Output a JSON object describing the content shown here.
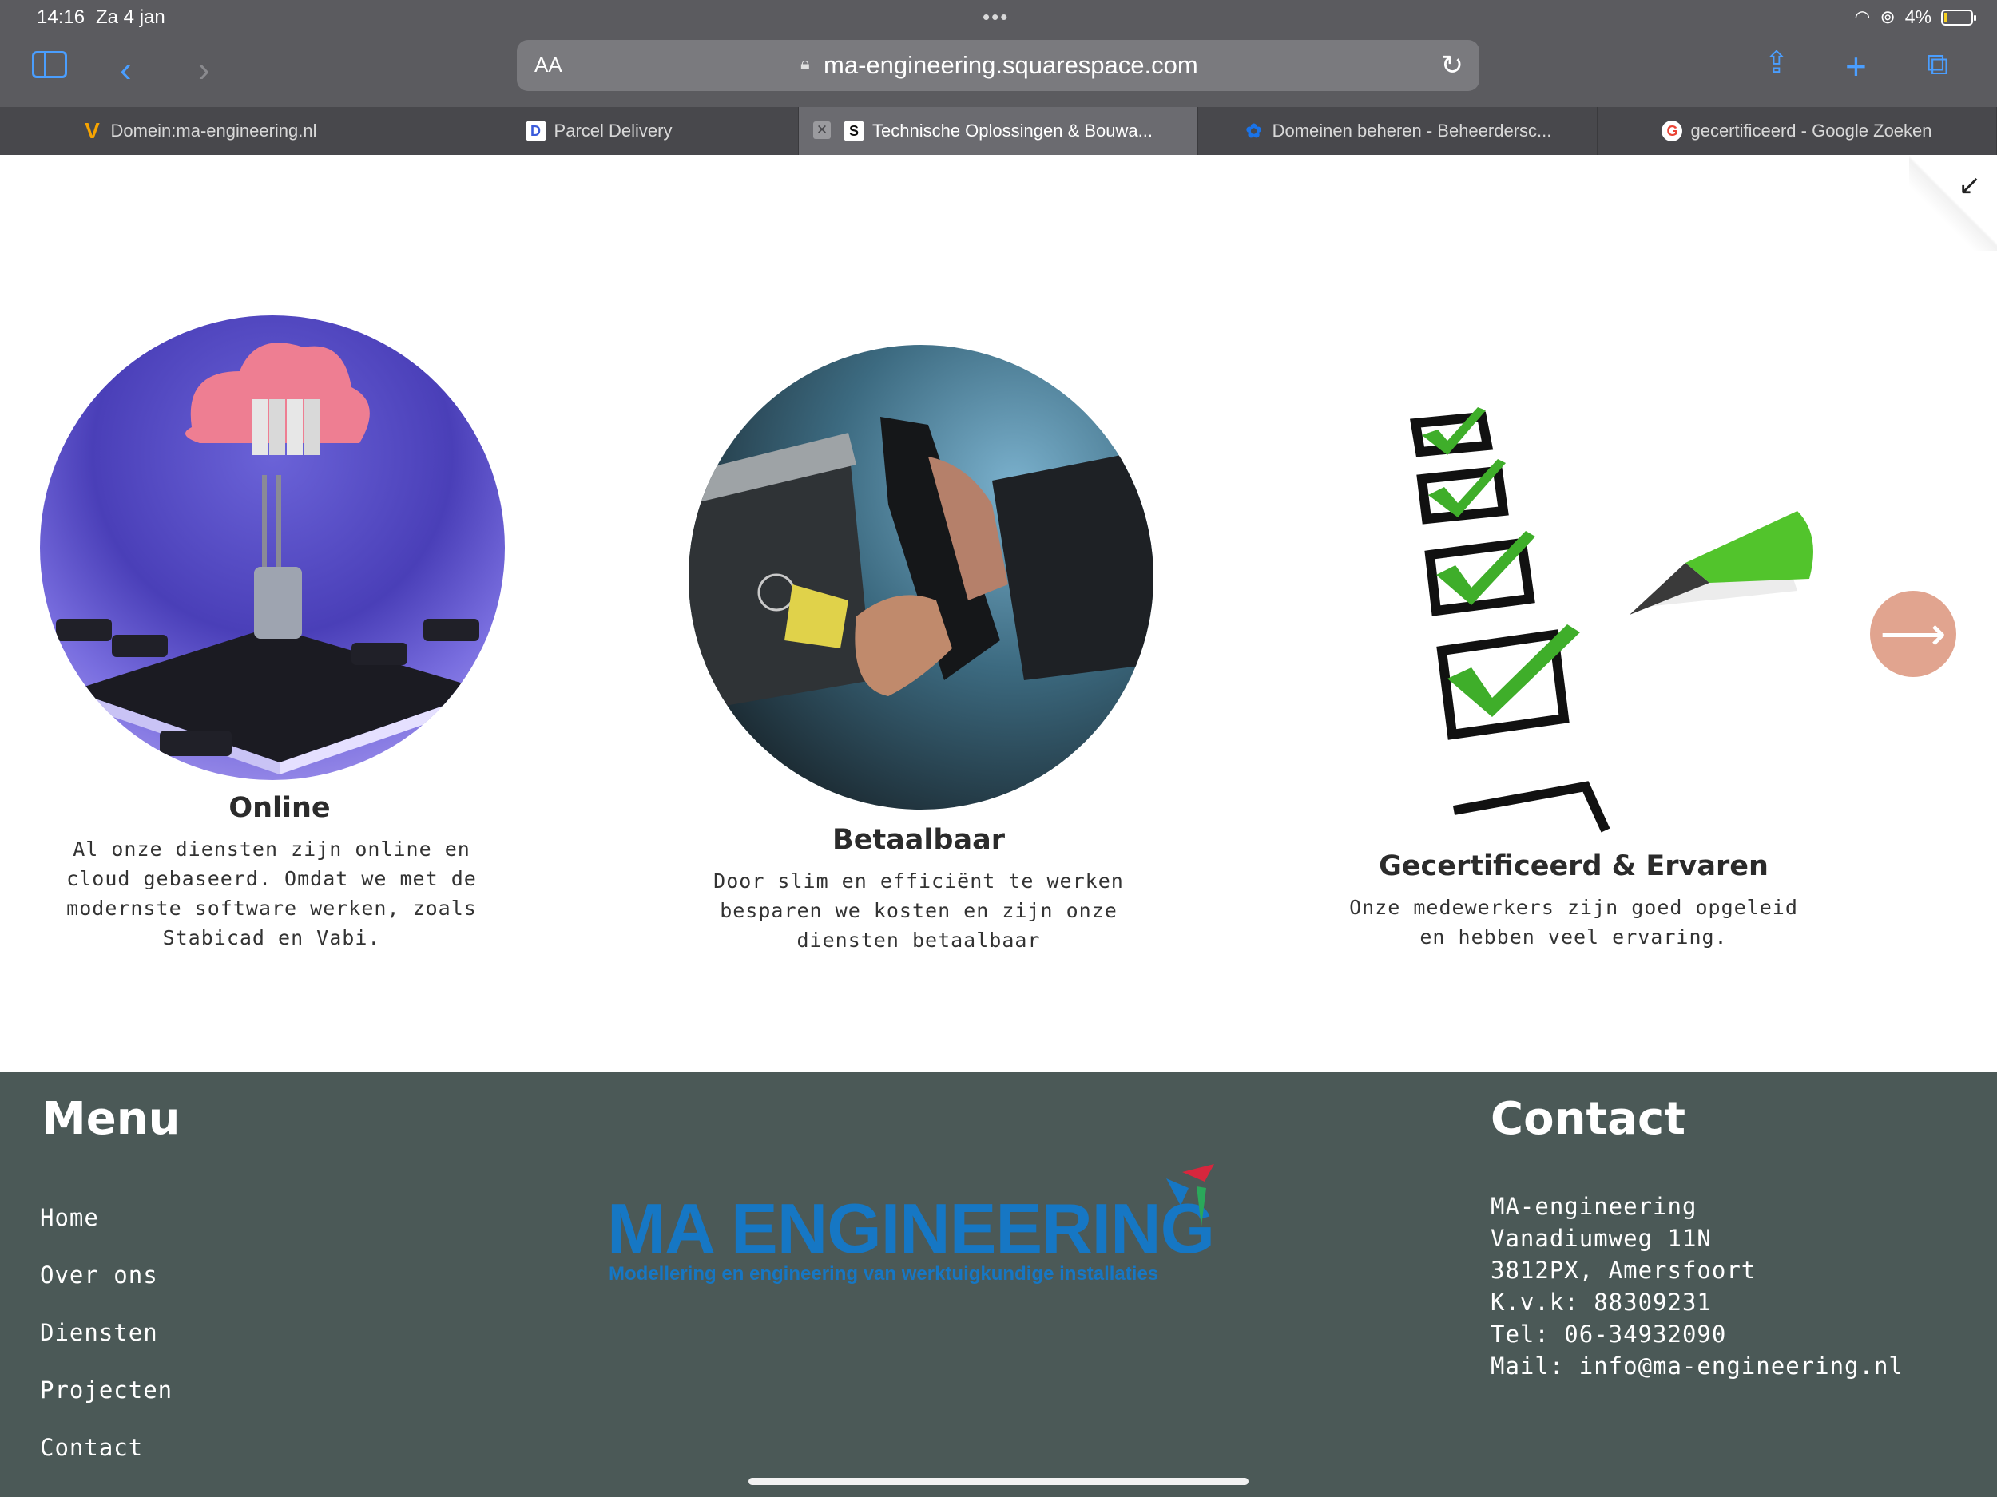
{
  "status_bar": {
    "time": "14:16",
    "date": "Za 4 jan",
    "battery": "4%"
  },
  "address_bar": {
    "aa": "AA",
    "url": "ma-engineering.squarespace.com"
  },
  "tabs": [
    {
      "title": "Domein:ma-engineering.nl",
      "favicon": "V",
      "favicon_color": "#f7a400"
    },
    {
      "title": "Parcel Delivery",
      "favicon": "D",
      "favicon_color": "#3b5bdb"
    },
    {
      "title": "Technische Oplossingen & Bouwa...",
      "favicon": "S",
      "favicon_color": "#ffffff",
      "active": true
    },
    {
      "title": "Domeinen beheren - Beheerdersc...",
      "favicon": "✿",
      "favicon_color": "#1a73e8"
    },
    {
      "title": "gecertificeerd - Google Zoeken",
      "favicon": "G",
      "favicon_color": "#ea4335"
    }
  ],
  "features": [
    {
      "title": "Online",
      "text": "Al onze diensten zijn online en cloud gebaseerd. Omdat we met de modernste software werken, zoals Stabicad en Vabi."
    },
    {
      "title": "Betaalbaar",
      "text": "Door slim en efficiënt te werken besparen we kosten en zijn onze diensten betaalbaar"
    },
    {
      "title": "Gecertificeerd & Ervaren",
      "text": "Onze medewerkers zijn goed opgeleid en hebben veel ervaring."
    }
  ],
  "footer": {
    "menu_heading": "Menu",
    "menu_items": [
      "Home",
      "Over ons",
      "Diensten",
      "Projecten",
      "Contact"
    ],
    "logo": {
      "name": "MA ENGINEERING",
      "tagline": "Modellering en engineering van werktuigkundige installaties"
    },
    "contact_heading": "Contact",
    "contact_lines": [
      "MA-engineering",
      "Vanadiumweg 11N",
      "3812PX, Amersfoort",
      "K.v.k: 88309231",
      "Tel: 06-34932090",
      "Mail: info@ma-engineering.nl"
    ]
  },
  "colors": {
    "footer_bg": "#4b5957",
    "accent_button": "#e1a48f",
    "chrome_blue": "#4a9eff",
    "logo_blue": "#1677c4"
  }
}
